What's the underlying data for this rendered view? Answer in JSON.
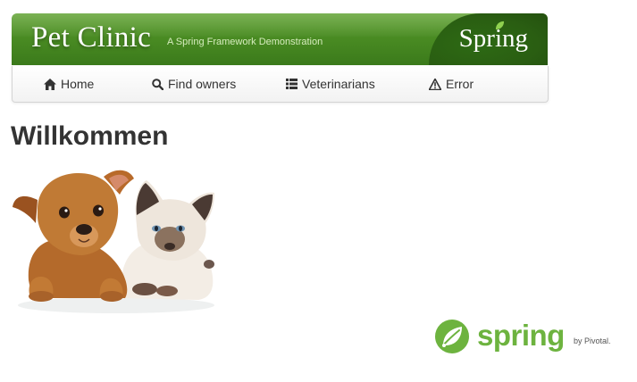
{
  "header": {
    "title": "Pet Clinic",
    "subtitle": "A Spring Framework Demonstration",
    "brand": "Spring"
  },
  "nav": {
    "items": [
      {
        "label": "Home",
        "icon": "home-icon"
      },
      {
        "label": "Find owners",
        "icon": "search-icon"
      },
      {
        "label": "Veterinarians",
        "icon": "list-icon"
      },
      {
        "label": "Error",
        "icon": "warning-icon"
      }
    ]
  },
  "main": {
    "heading": "Willkommen",
    "image": "puppy-and-kitten"
  },
  "footer": {
    "logo_text": "spring",
    "logo_by": "by Pivotal."
  },
  "colors": {
    "banner_green": "#4a8c23",
    "spring_green": "#6db33f",
    "text": "#333333"
  }
}
